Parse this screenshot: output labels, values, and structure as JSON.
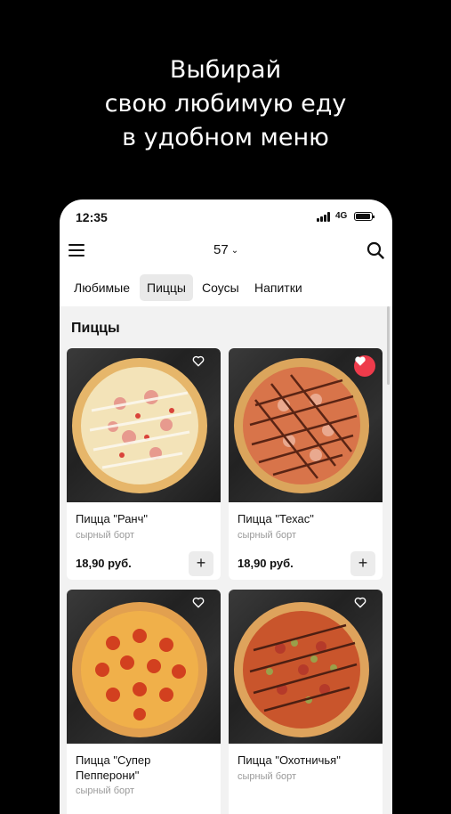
{
  "promo": {
    "line1": "Выбирай",
    "line2": "свою любимую еду",
    "line3": "в удобном меню"
  },
  "status": {
    "time": "12:35",
    "network": "4G"
  },
  "header": {
    "selector_value": "57",
    "chevron": "chevron-down-icon"
  },
  "tabs": [
    {
      "label": "Любимые",
      "active": false
    },
    {
      "label": "Пиццы",
      "active": true
    },
    {
      "label": "Соусы",
      "active": false
    },
    {
      "label": "Напитки",
      "active": false
    }
  ],
  "section": {
    "title": "Пиццы"
  },
  "products": [
    {
      "name": "Пицца \"Ранч\"",
      "subtitle": "сырный борт",
      "price": "18,90 руб.",
      "favorite": false
    },
    {
      "name": "Пицца \"Техас\"",
      "subtitle": "сырный борт",
      "price": "18,90 руб.",
      "favorite": true
    },
    {
      "name": "Пицца \"Супер Пепперони\"",
      "subtitle": "сырный борт",
      "price": "",
      "favorite": false
    },
    {
      "name": "Пицца \"Охотничья\"",
      "subtitle": "сырный борт",
      "price": "",
      "favorite": false
    }
  ],
  "colors": {
    "background": "#000000",
    "favorite_active": "#ee3b4b",
    "content_bg": "#f2f2f2"
  }
}
